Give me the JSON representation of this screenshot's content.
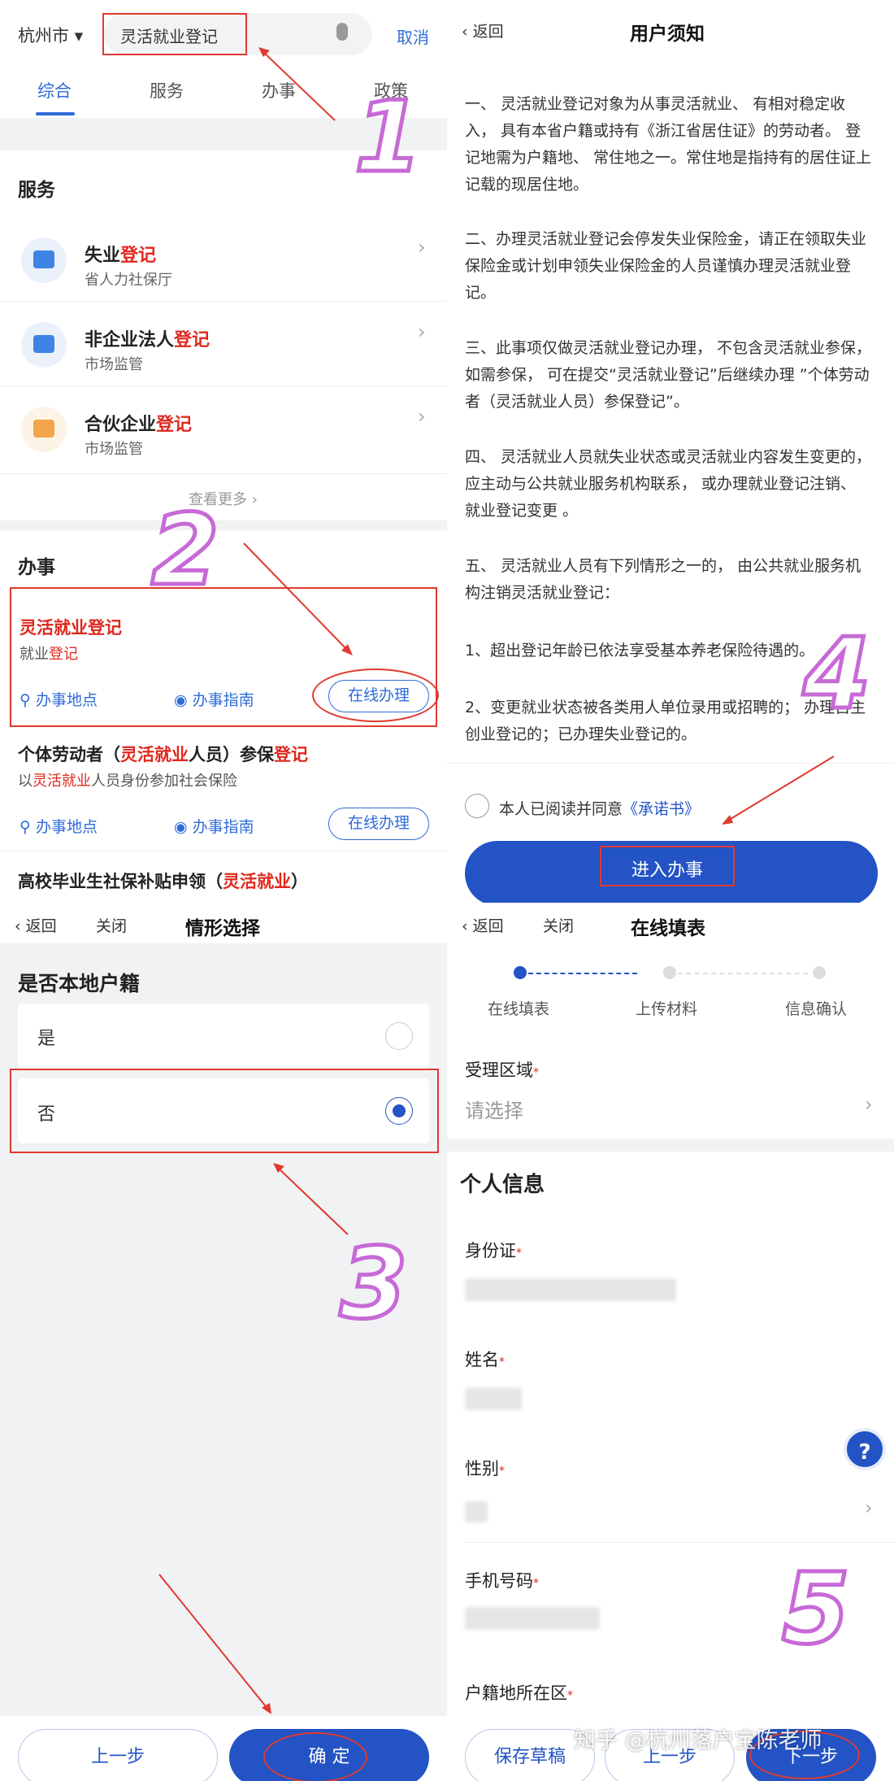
{
  "panel1": {
    "city": "杭州市",
    "search_value": "灵活就业登记",
    "cancel": "取消",
    "tabs": [
      "综合",
      "服务",
      "办事",
      "政策"
    ],
    "services_title": "服务",
    "services": [
      {
        "title_plain": "失业",
        "title_hl": "登记",
        "sub": "省人力社保厅"
      },
      {
        "title_plain": "非企业法人",
        "title_hl": "登记",
        "sub": "市场监管"
      },
      {
        "title_plain": "合伙企业",
        "title_hl": "登记",
        "sub": "市场监管"
      }
    ],
    "see_more": "查看更多 ›",
    "tasks_title": "办事",
    "task1": {
      "title": "灵活就业登记",
      "sub_plain": "就业",
      "sub_hl": "登记",
      "location": "办事地点",
      "guide": "办事指南",
      "online": "在线办理"
    },
    "task2": {
      "t1": "个体劳动者（",
      "t2": "灵活就业",
      "t3": "人员）参保",
      "t4": "登记",
      "s1": "以",
      "s2": "灵活就业",
      "s3": "人员身份参加社会保险",
      "location": "办事地点",
      "guide": "办事指南",
      "online": "在线办理"
    },
    "task3": {
      "t1": "高校毕业生社保补贴申领（",
      "t2": "灵活就业",
      "t3": "）"
    }
  },
  "panel2": {
    "back": "返回",
    "title": "用户须知",
    "p1": "一、 灵活就业登记对象为从事灵活就业、 有相对稳定收入， 具有本省户籍或持有《浙江省居住证》的劳动者。 登记地需为户籍地、 常住地之一。常住地是指持有的居住证上记载的现居住地。",
    "p2": "二、办理灵活就业登记会停发失业保险金，请正在领取失业保险金或计划申领失业保险金的人员谨慎办理灵活就业登记。",
    "p3": "三、此事项仅做灵活就业登记办理， 不包含灵活就业参保， 如需参保， 可在提交“灵活就业登记”后继续办理 ”个体劳动者（灵活就业人员）参保登记”。",
    "p4": "四、 灵活就业人员就失业状态或灵活就业内容发生变更的， 应主动与公共就业服务机构联系， 或办理就业登记注销、 就业登记变更 。",
    "p5": "五、 灵活就业人员有下列情形之一的， 由公共就业服务机构注销灵活就业登记：",
    "p6": "1、超出登记年龄已依法享受基本养老保险待遇的。",
    "p7": "2、变更就业状态被各类用人单位录用或招聘的； 办理自主创业登记的；已办理失业登记的。",
    "agree_text": "本人已阅读并同意",
    "agree_link": "《承诺书》",
    "enter": "进入办事"
  },
  "panel3": {
    "back": "返回",
    "close": "关闭",
    "title": "情形选择",
    "question": "是否本地户籍",
    "options": [
      "是",
      "否"
    ],
    "prev": "上一步",
    "confirm": "确  定"
  },
  "panel4": {
    "back": "返回",
    "close": "关闭",
    "title": "在线填表",
    "steps": [
      "在线填表",
      "上传材料",
      "信息确认"
    ],
    "area_label": "受理区域",
    "area_placeholder": "请选择",
    "section": "个人信息",
    "id_label": "身份证",
    "name_label": "姓名",
    "gender_label": "性别",
    "phone_label": "手机号码",
    "hukou_label": "户籍地所在区",
    "help": "?",
    "save": "保存草稿",
    "prev": "上一步",
    "next": "下一步",
    "watermark": "知乎 @杭州落户宝陈老师"
  },
  "annotations": [
    "1",
    "2",
    "3",
    "4",
    "5"
  ],
  "colors": {
    "primary": "#2353c4",
    "highlight_red": "#e0281e",
    "annotation_purple": "#c76ad6"
  }
}
